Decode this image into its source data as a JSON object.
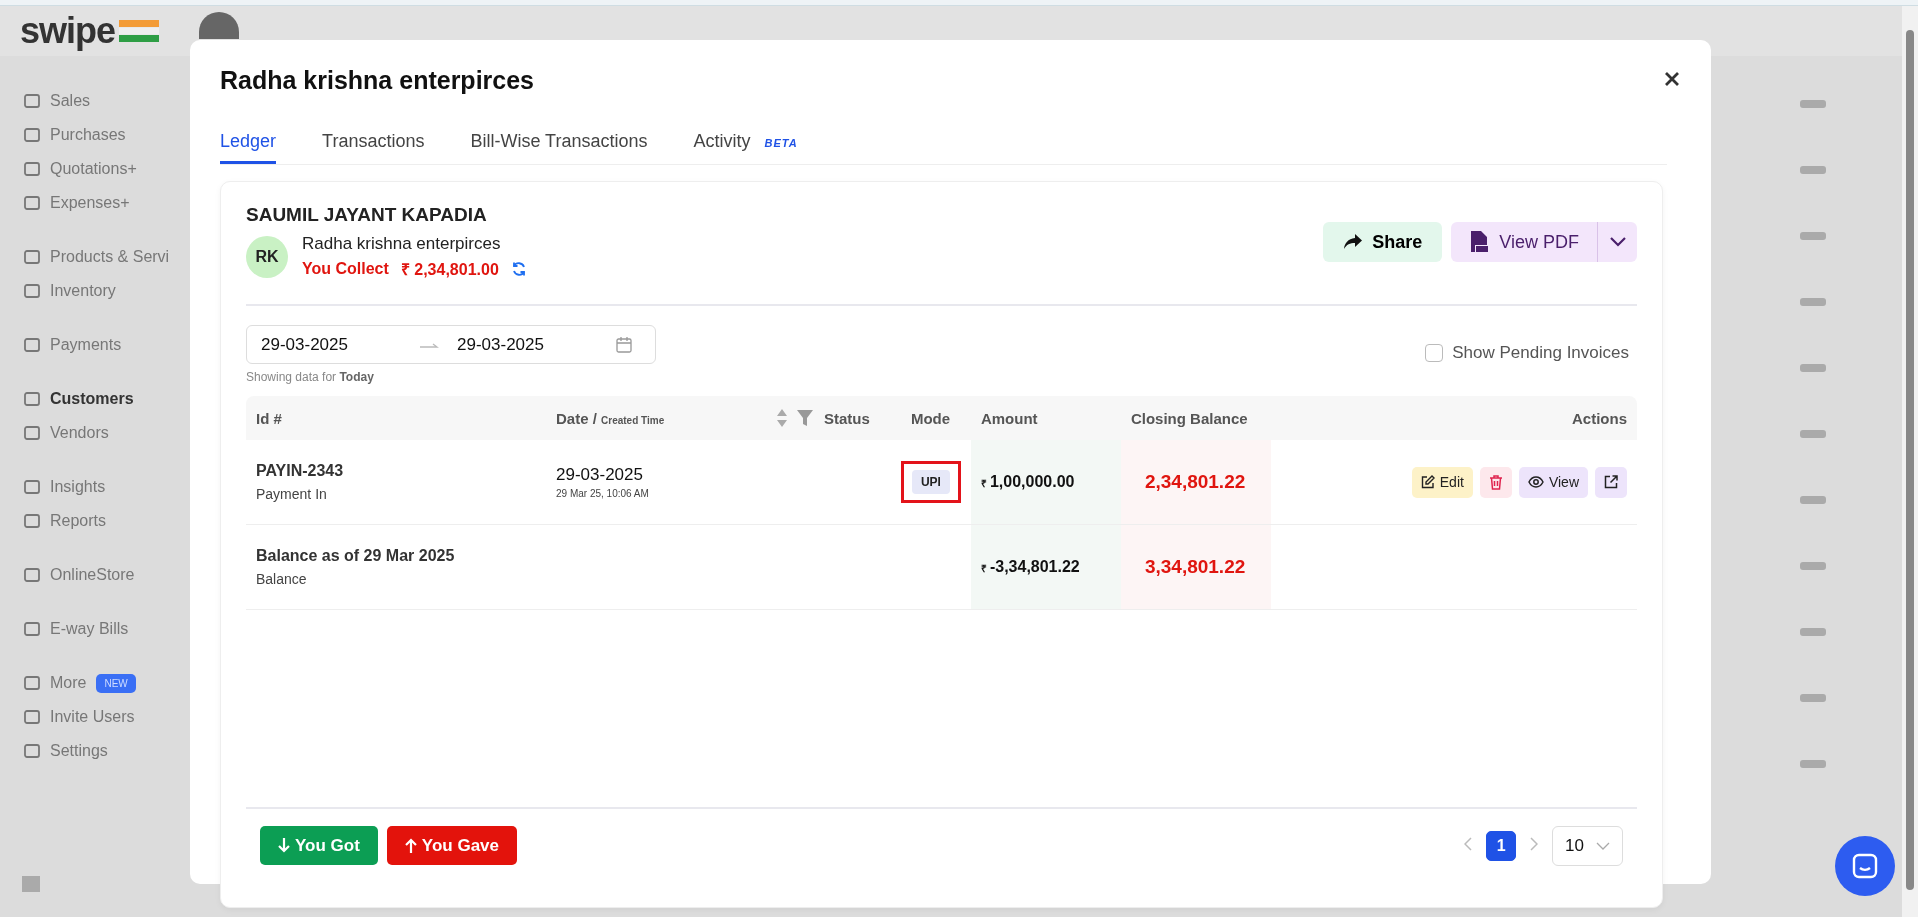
{
  "sidebar": {
    "logo": "swipe",
    "groups": [
      {
        "items": [
          {
            "label": "Sales",
            "selected": false
          },
          {
            "label": "Purchases",
            "selected": false
          },
          {
            "label": "Quotations+",
            "selected": false
          },
          {
            "label": "Expenses+",
            "selected": false
          }
        ]
      },
      {
        "items": [
          {
            "label": "Products & Servi",
            "selected": false
          },
          {
            "label": "Inventory",
            "selected": false
          }
        ]
      },
      {
        "items": [
          {
            "label": "Payments",
            "selected": false
          }
        ]
      },
      {
        "items": [
          {
            "label": "Customers",
            "selected": true
          },
          {
            "label": "Vendors",
            "selected": false
          }
        ]
      },
      {
        "items": [
          {
            "label": "Insights",
            "selected": false
          },
          {
            "label": "Reports",
            "selected": false
          }
        ]
      },
      {
        "items": [
          {
            "label": "OnlineStore",
            "selected": false
          }
        ]
      },
      {
        "items": [
          {
            "label": "E-way Bills",
            "selected": false
          }
        ]
      },
      {
        "items": [
          {
            "label": "More",
            "selected": false,
            "badge": "NEW"
          },
          {
            "label": "Invite Users",
            "selected": false
          },
          {
            "label": "Settings",
            "selected": false
          }
        ]
      }
    ]
  },
  "modal": {
    "title": "Radha krishna enterpirces",
    "tabs": [
      {
        "label": "Ledger",
        "selected": true
      },
      {
        "label": "Transactions",
        "selected": false
      },
      {
        "label": "Bill-Wise Transactions",
        "selected": false
      },
      {
        "label": "Activity",
        "selected": false,
        "badge": "BETA"
      }
    ],
    "party": {
      "name": "SAUMIL JAYANT KAPADIA",
      "initials": "RK",
      "company": "Radha krishna enterpirces",
      "balance_label": "You Collect",
      "balance": "₹ 2,34,801.00"
    },
    "share_button": "Share",
    "view_pdf_button": "View PDF",
    "date_range": {
      "from": "29-03-2025",
      "to": "29-03-2025"
    },
    "range_note": "Showing data for **Today**",
    "show_pending": {
      "label": "Show Pending Invoices",
      "checked": false
    },
    "table": {
      "columns": [
        {
          "label": "Id #"
        },
        {
          "label": "Date / ",
          "sub": "Created Time",
          "sortable": true
        },
        {
          "label": "Status"
        },
        {
          "label": "Mode"
        },
        {
          "label": "Amount"
        },
        {
          "label": "Closing Balance"
        },
        {
          "label": "Actions"
        }
      ],
      "rows": [
        {
          "id": "PAYIN-2343",
          "type": "Payment In",
          "date": "29-03-2025",
          "time": "29 Mar 25, 10:06 AM",
          "mode": "UPI",
          "mode_highlighted": true,
          "currency": "₹",
          "amount": "1,00,000.00",
          "closing": "2,34,801.22",
          "actions": [
            {
              "kind": "edit",
              "label": "Edit"
            },
            {
              "kind": "delete"
            },
            {
              "kind": "view",
              "label": "View"
            },
            {
              "kind": "open"
            }
          ]
        },
        {
          "id": "Balance as of 29 Mar 2025",
          "type": "Balance",
          "currency": "₹",
          "amount": "-3,34,801.22",
          "closing": "3,34,801.22",
          "actions": []
        }
      ]
    },
    "you_got_button": "You Got",
    "you_gave_button": "You Gave",
    "pagination": {
      "pages": [
        {
          "label": "1",
          "selected": true
        }
      ],
      "page_size": "10"
    }
  }
}
